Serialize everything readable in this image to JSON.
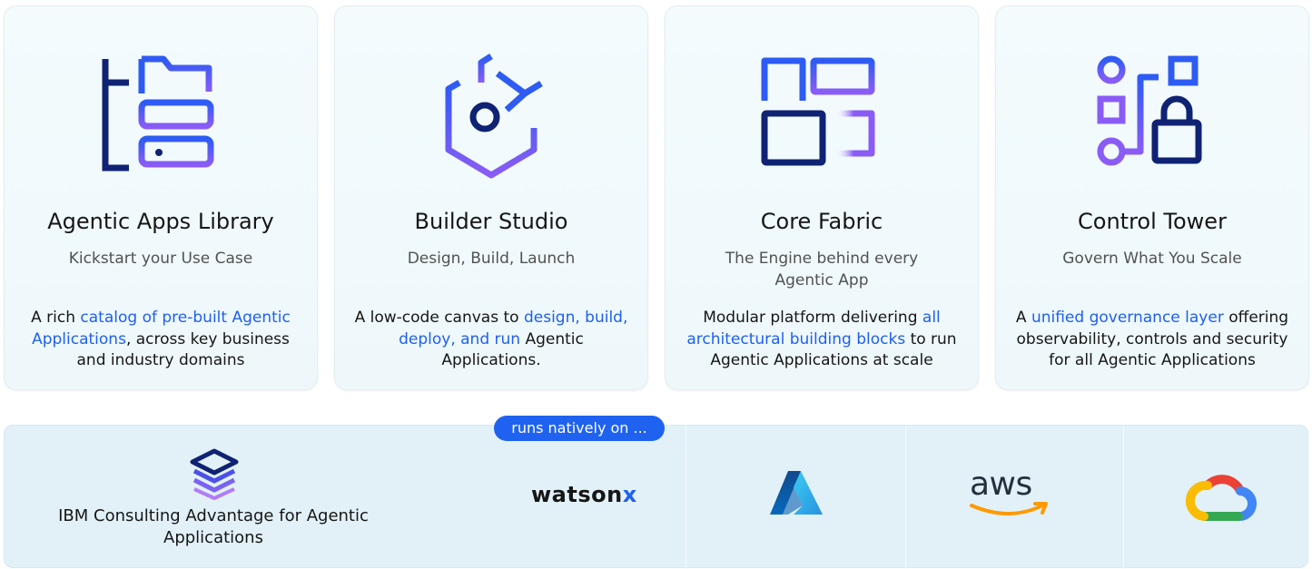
{
  "cards": [
    {
      "icon": "apps-library-icon",
      "title": "Agentic Apps Library",
      "subtitle": "Kickstart your Use Case",
      "desc_pre": "A rich ",
      "desc_hl": "catalog of pre-built Agentic Applications",
      "desc_post": ", across key business and industry domains"
    },
    {
      "icon": "builder-studio-icon",
      "title": "Builder Studio",
      "subtitle": "Design, Build, Launch",
      "desc_pre": "A low-code canvas to ",
      "desc_hl": "design, build, deploy, and run",
      "desc_post": " Agentic Applications."
    },
    {
      "icon": "core-fabric-icon",
      "title": "Core Fabric",
      "subtitle": "The Engine behind every Agentic App",
      "desc_pre": "Modular platform delivering ",
      "desc_hl": "all architectural building blocks",
      "desc_post": " to run Agentic Applications at scale"
    },
    {
      "icon": "control-tower-icon",
      "title": "Control Tower",
      "subtitle": "Govern What You Scale",
      "desc_pre": "A ",
      "desc_hl": "unified governance layer",
      "desc_post": " offering observability, controls and security for all Agentic Applications"
    }
  ],
  "bottom": {
    "brand_name": "IBM Consulting Advantage for Agentic Applications",
    "pill": "runs natively on ...",
    "platforms": {
      "watsonx_a": "watson",
      "watsonx_b": "x",
      "azure_icon": "azure-logo-icon",
      "aws_text": "aws",
      "gcp_icon": "google-cloud-logo-icon"
    }
  },
  "colors": {
    "accent_blue": "#1f5ff0",
    "navy": "#0f2273",
    "purple": "#8b5cf6",
    "card_bg": "#f1fafc",
    "band_bg": "#e2f1f8"
  }
}
